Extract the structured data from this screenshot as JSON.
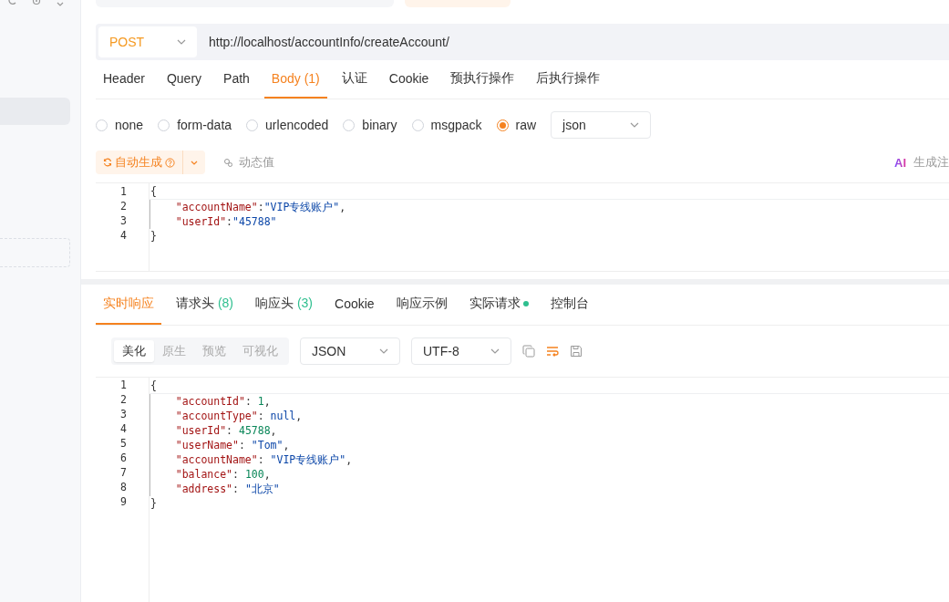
{
  "url_bar": {
    "method": "POST",
    "url": "http://localhost/accountInfo/createAccount/"
  },
  "request_tabs": [
    {
      "label": "Header",
      "selected": false
    },
    {
      "label": "Query",
      "selected": false
    },
    {
      "label": "Path",
      "selected": false
    },
    {
      "label": "Body",
      "count": "(1)",
      "selected": true
    },
    {
      "label": "认证",
      "selected": false
    },
    {
      "label": "Cookie",
      "selected": false
    },
    {
      "label": "预执行操作",
      "selected": false
    },
    {
      "label": "后执行操作",
      "selected": false
    }
  ],
  "body_types": [
    {
      "label": "none",
      "selected": false
    },
    {
      "label": "form-data",
      "selected": false
    },
    {
      "label": "urlencoded",
      "selected": false
    },
    {
      "label": "binary",
      "selected": false
    },
    {
      "label": "msgpack",
      "selected": false
    },
    {
      "label": "raw",
      "selected": true
    }
  ],
  "format_select": "json",
  "auto_generate_button": "自动生成",
  "dynamic_value_button": "动态值",
  "ai_button": {
    "logo": "AI",
    "label": "生成注"
  },
  "request_body": [
    {
      "number": "1",
      "text": "{"
    },
    {
      "number": "2",
      "text": "    \"accountName\":\"VIP专线账户\","
    },
    {
      "number": "3",
      "text": "    \"userId\":\"45788\""
    },
    {
      "number": "4",
      "text": "}"
    }
  ],
  "response_tabs": [
    {
      "label": "实时响应",
      "selected": true
    },
    {
      "label": "请求头",
      "count": "(8)",
      "selected": false
    },
    {
      "label": "响应头",
      "count": "(3)",
      "selected": false
    },
    {
      "label": "Cookie",
      "selected": false
    },
    {
      "label": "响应示例",
      "selected": false
    },
    {
      "label": "实际请求",
      "indicator": true,
      "selected": false
    },
    {
      "label": "控制台",
      "selected": false
    }
  ],
  "view_modes": [
    {
      "label": "美化",
      "selected": true
    },
    {
      "label": "原生",
      "selected": false
    },
    {
      "label": "预览",
      "selected": false
    },
    {
      "label": "可视化",
      "selected": false
    }
  ],
  "content_type_select": "JSON",
  "encoding_select": "UTF-8",
  "response_body": [
    {
      "number": "1",
      "text": "{"
    },
    {
      "number": "2",
      "text": "    \"accountId\": 1,"
    },
    {
      "number": "3",
      "text": "    \"accountType\": null,"
    },
    {
      "number": "4",
      "text": "    \"userId\": 45788,"
    },
    {
      "number": "5",
      "text": "    \"userName\": \"Tom\","
    },
    {
      "number": "6",
      "text": "    \"accountName\": \"VIP专线账户\","
    },
    {
      "number": "7",
      "text": "    \"balance\": 100,"
    },
    {
      "number": "8",
      "text": "    \"address\": \"北京\""
    },
    {
      "number": "9",
      "text": "}"
    }
  ]
}
